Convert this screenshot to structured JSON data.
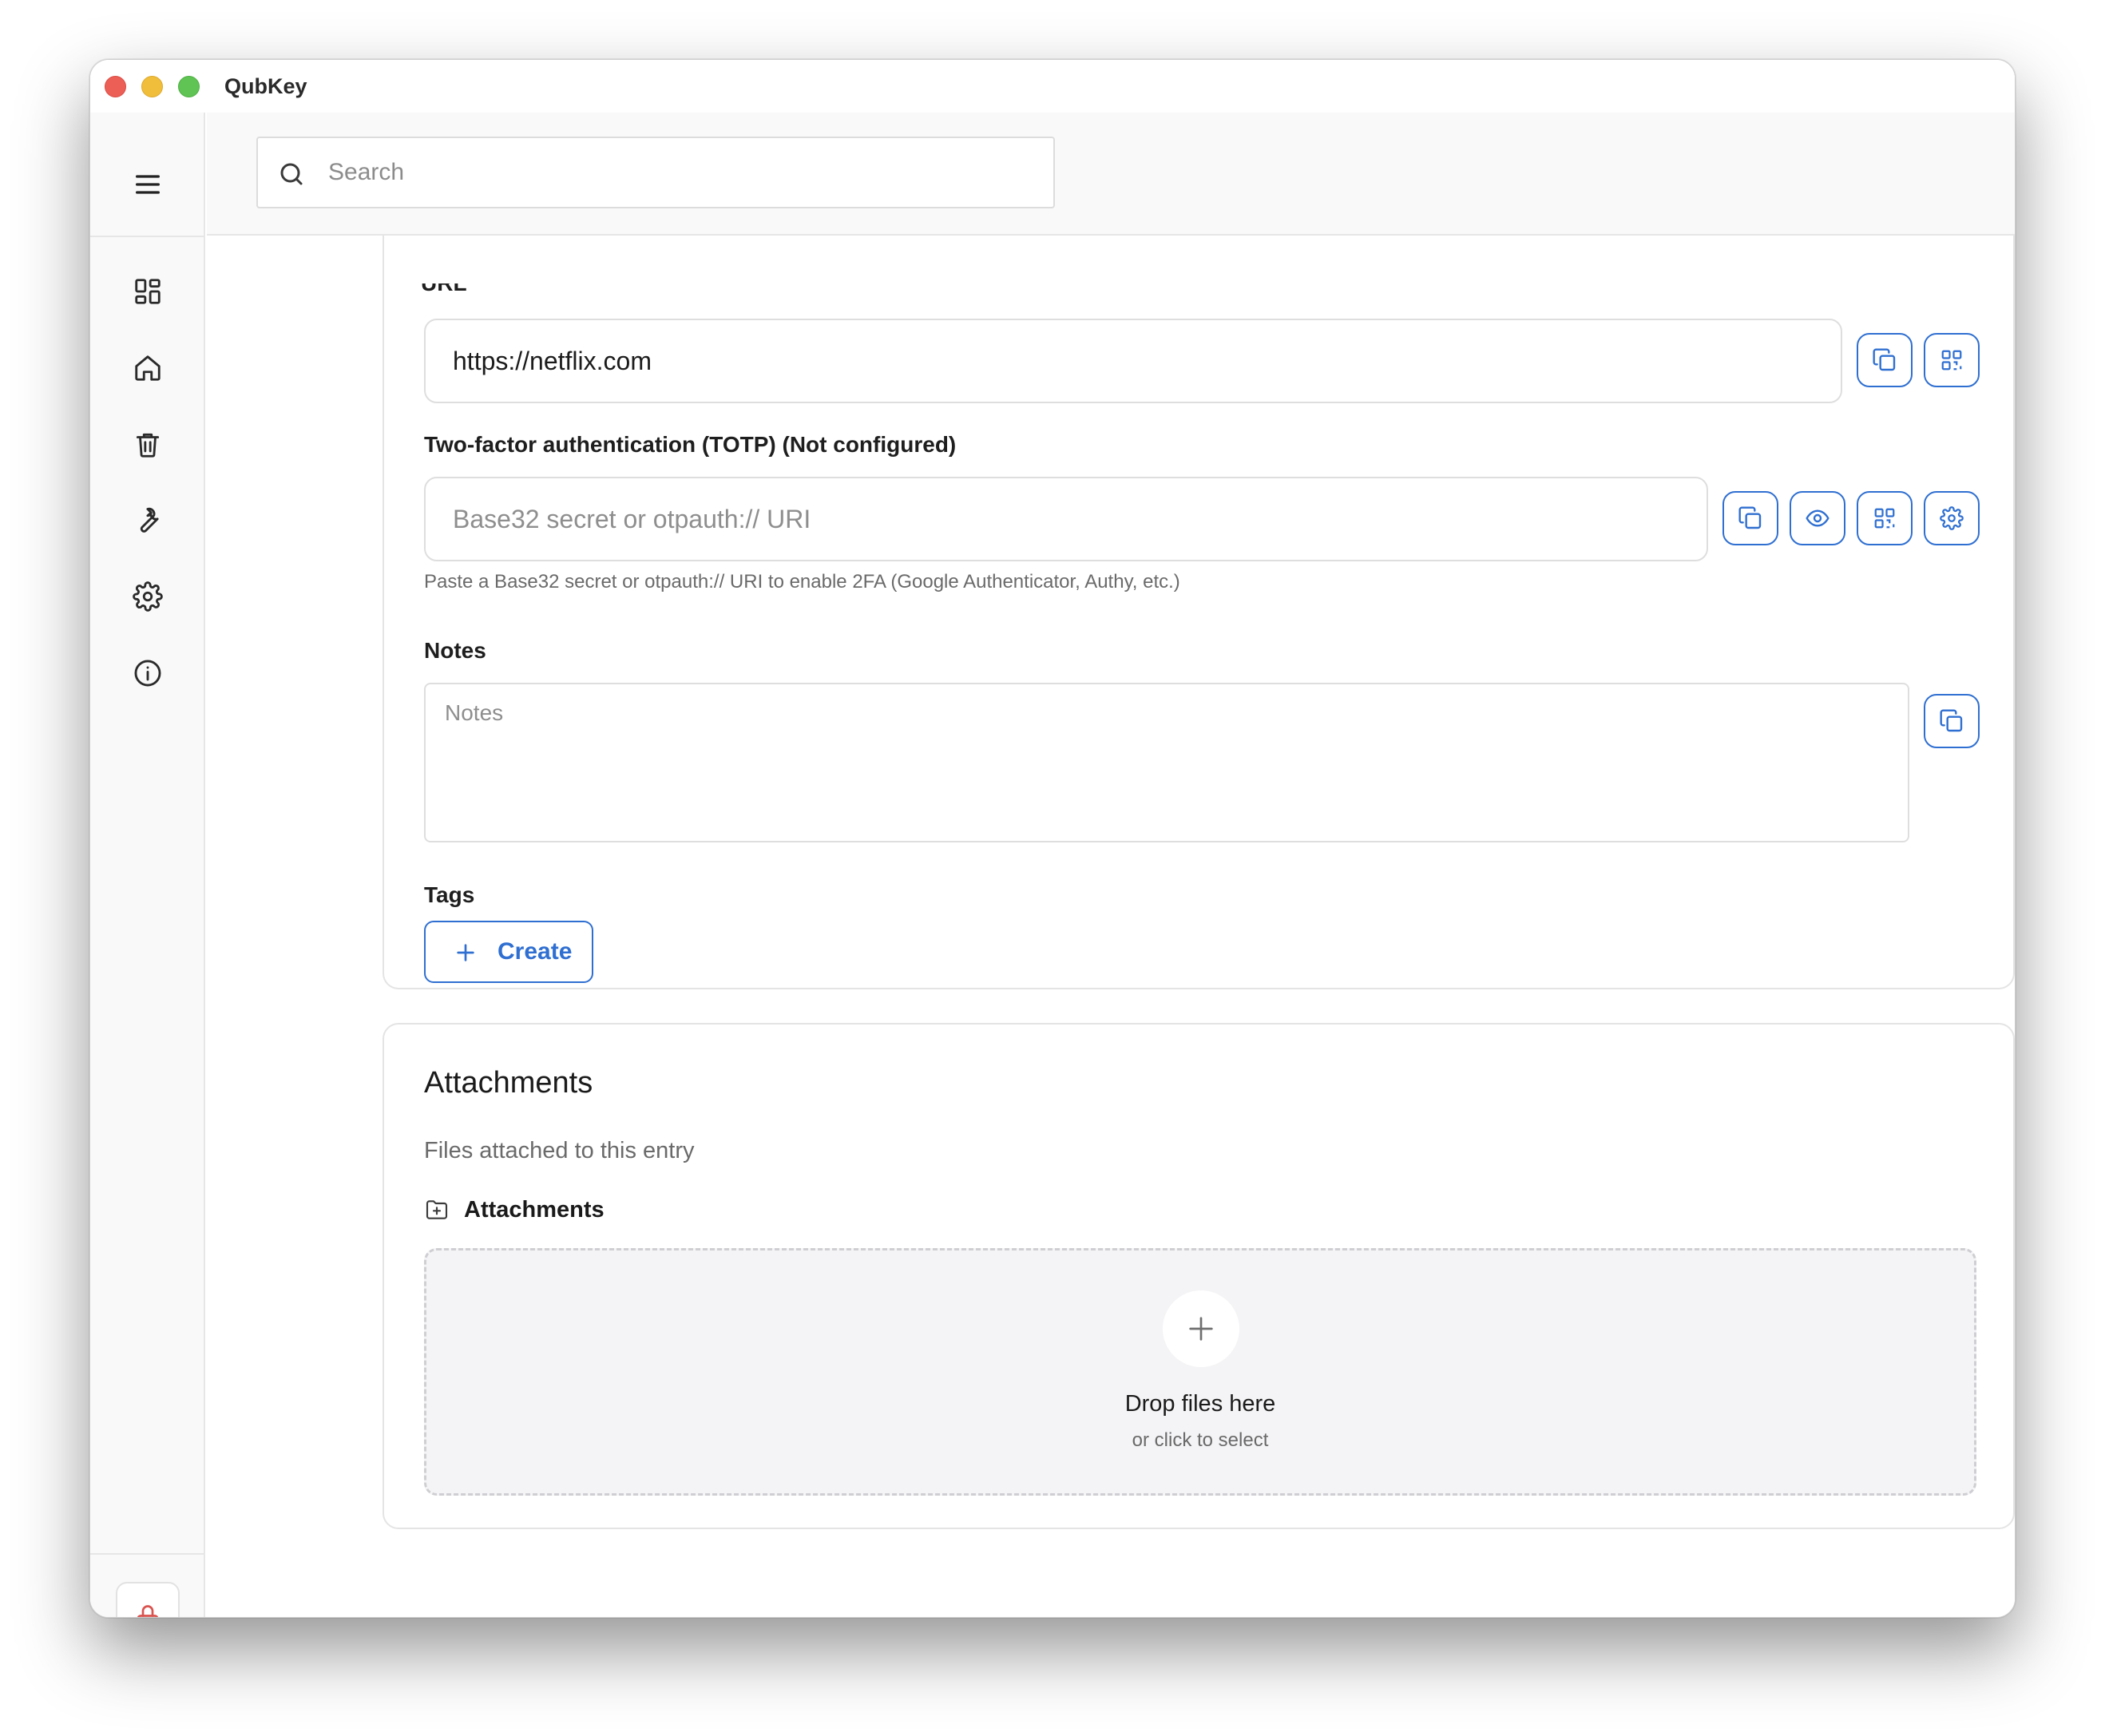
{
  "app": {
    "title": "QubKey"
  },
  "search": {
    "placeholder": "Search"
  },
  "sidebar": {
    "items": [
      {
        "name": "dashboard",
        "icon": "grid-icon"
      },
      {
        "name": "home",
        "icon": "home-icon"
      },
      {
        "name": "trash",
        "icon": "trash-icon"
      },
      {
        "name": "tools",
        "icon": "wrench-icon"
      },
      {
        "name": "settings",
        "icon": "gear-icon"
      },
      {
        "name": "about",
        "icon": "info-icon"
      }
    ],
    "lock_icon": "lock-icon"
  },
  "entry": {
    "url": {
      "value": "https://netflix.com"
    },
    "totp": {
      "label": "Two-factor authentication (TOTP) (Not configured)",
      "placeholder": "Base32 secret or otpauth:// URI",
      "hint": "Paste a Base32 secret or otpauth:// URI to enable 2FA (Google Authenticator, Authy, etc.)"
    },
    "notes": {
      "label": "Notes",
      "placeholder": "Notes"
    },
    "tags": {
      "label": "Tags",
      "create_label": "Create"
    }
  },
  "attachments": {
    "title": "Attachments",
    "subtitle": "Files attached to this entry",
    "section_label": "Attachments",
    "drop_title": "Drop files here",
    "drop_sub": "or click to select"
  },
  "colors": {
    "accent": "#2f6fd1",
    "lock": "#d9534f",
    "close": "#ec5f57",
    "minimize": "#f1be3b",
    "maximize": "#60c454"
  }
}
